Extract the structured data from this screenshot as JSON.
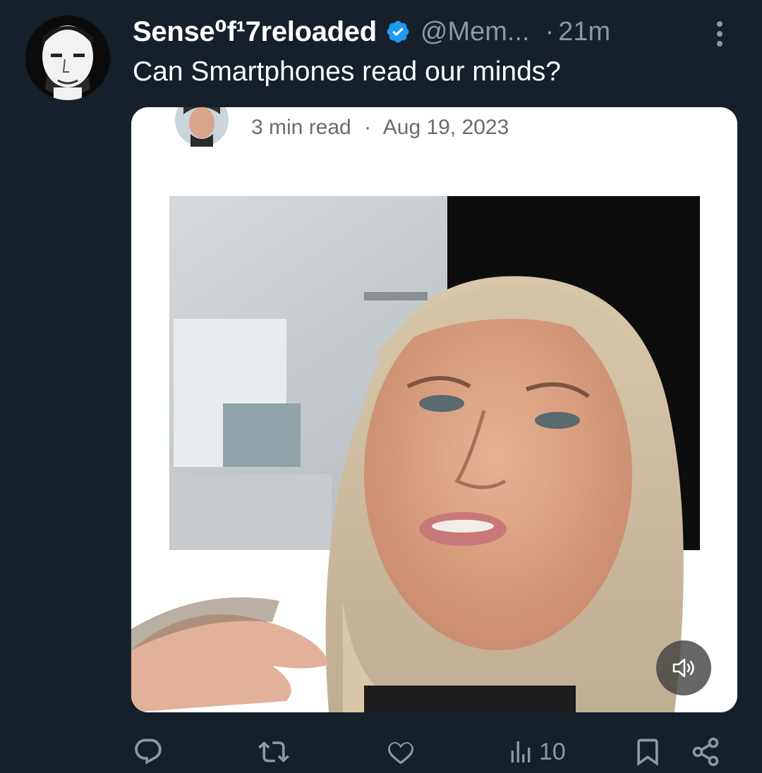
{
  "tweet": {
    "display_name": "Sense⁰f¹7reloaded",
    "handle": "@Mem...",
    "separator": "·",
    "time": "21m",
    "text": "Can Smartphones read our minds?"
  },
  "media": {
    "read_time": "3 min read",
    "meta_separator": "·",
    "date": "Aug 19, 2023"
  },
  "actions": {
    "views_count": "10"
  },
  "colors": {
    "background": "#15202b",
    "secondary_text": "#8b98a5",
    "verified_blue": "#1d9bf0"
  },
  "icons": [
    "more-vertical-icon",
    "verified-badge-icon",
    "reply-icon",
    "retweet-icon",
    "like-icon",
    "views-icon",
    "bookmark-icon",
    "share-icon",
    "sound-icon"
  ]
}
